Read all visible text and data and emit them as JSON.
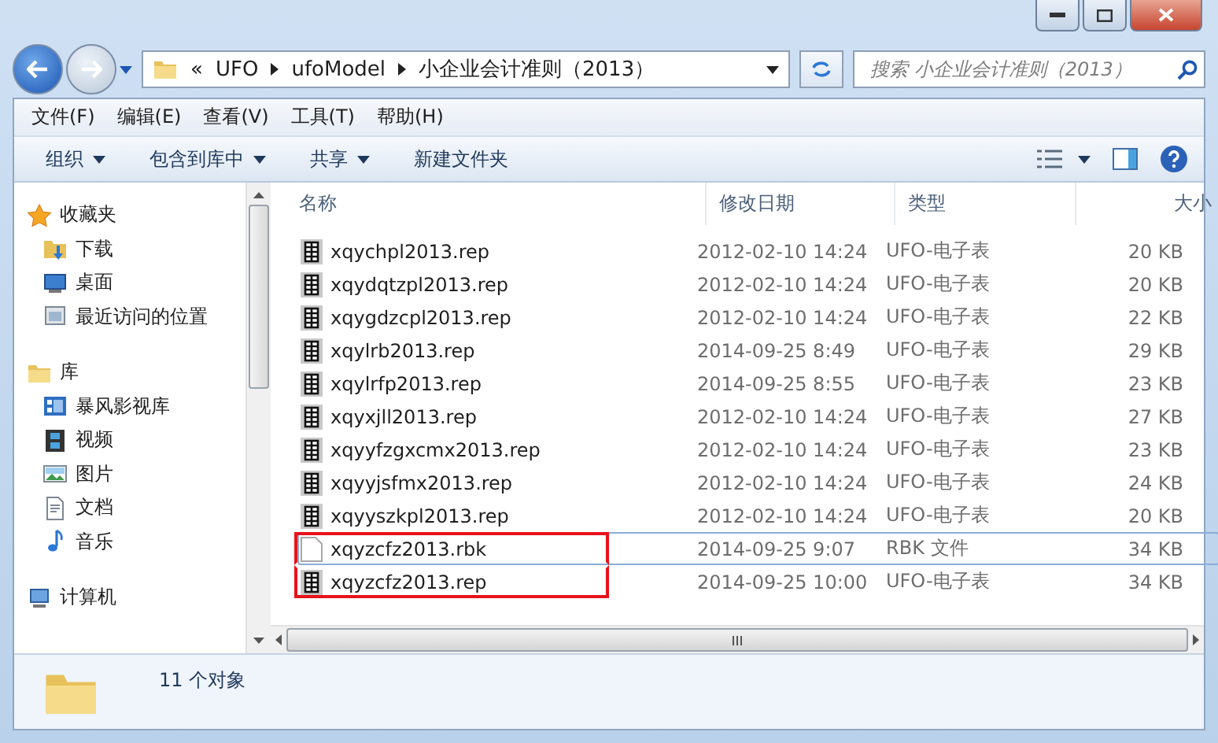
{
  "address": {
    "overflow": "«",
    "crumbs": [
      "UFO",
      "ufoModel",
      "小企业会计准则（2013）"
    ]
  },
  "search": {
    "placeholder": "搜索 小企业会计准则（2013）"
  },
  "menu": [
    "文件(F)",
    "编辑(E)",
    "查看(V)",
    "工具(T)",
    "帮助(H)"
  ],
  "toolbar": [
    {
      "label": "组织",
      "dropdown": true
    },
    {
      "label": "包含到库中",
      "dropdown": true
    },
    {
      "label": "共享",
      "dropdown": true
    },
    {
      "label": "新建文件夹",
      "dropdown": false
    }
  ],
  "sidebar": [
    {
      "label": "收藏夹",
      "kind": "favorites",
      "children": [
        {
          "label": "下载",
          "kind": "download"
        },
        {
          "label": "桌面",
          "kind": "desktop"
        },
        {
          "label": "最近访问的位置",
          "kind": "recent"
        }
      ]
    },
    {
      "label": "库",
      "kind": "library",
      "children": [
        {
          "label": "暴风影视库",
          "kind": "media"
        },
        {
          "label": "视频",
          "kind": "video"
        },
        {
          "label": "图片",
          "kind": "pictures"
        },
        {
          "label": "文档",
          "kind": "documents"
        },
        {
          "label": "音乐",
          "kind": "music"
        }
      ]
    },
    {
      "label": "计算机",
      "kind": "computer"
    }
  ],
  "columns": [
    "名称",
    "修改日期",
    "类型",
    "大小"
  ],
  "files": [
    {
      "name": "xqychpl2013.rep",
      "date": "2012-02-10 14:24",
      "type": "UFO-电子表",
      "size": "20 KB",
      "kind": "rep",
      "selected": false,
      "boxed": false
    },
    {
      "name": "xqydqtzpl2013.rep",
      "date": "2012-02-10 14:24",
      "type": "UFO-电子表",
      "size": "20 KB",
      "kind": "rep",
      "selected": false,
      "boxed": false
    },
    {
      "name": "xqygdzcpl2013.rep",
      "date": "2012-02-10 14:24",
      "type": "UFO-电子表",
      "size": "22 KB",
      "kind": "rep",
      "selected": false,
      "boxed": false
    },
    {
      "name": "xqylrb2013.rep",
      "date": "2014-09-25 8:49",
      "type": "UFO-电子表",
      "size": "29 KB",
      "kind": "rep",
      "selected": false,
      "boxed": false
    },
    {
      "name": "xqylrfp2013.rep",
      "date": "2014-09-25 8:55",
      "type": "UFO-电子表",
      "size": "23 KB",
      "kind": "rep",
      "selected": false,
      "boxed": false
    },
    {
      "name": "xqyxjll2013.rep",
      "date": "2012-02-10 14:24",
      "type": "UFO-电子表",
      "size": "27 KB",
      "kind": "rep",
      "selected": false,
      "boxed": false
    },
    {
      "name": "xqyyfzgxcmx2013.rep",
      "date": "2012-02-10 14:24",
      "type": "UFO-电子表",
      "size": "23 KB",
      "kind": "rep",
      "selected": false,
      "boxed": false
    },
    {
      "name": "xqyyjsfmx2013.rep",
      "date": "2012-02-10 14:24",
      "type": "UFO-电子表",
      "size": "24 KB",
      "kind": "rep",
      "selected": false,
      "boxed": false
    },
    {
      "name": "xqyyszkpl2013.rep",
      "date": "2012-02-10 14:24",
      "type": "UFO-电子表",
      "size": "20 KB",
      "kind": "rep",
      "selected": false,
      "boxed": false
    },
    {
      "name": "xqyzcfz2013.rbk",
      "date": "2014-09-25 9:07",
      "type": "RBK 文件",
      "size": "34 KB",
      "kind": "blank",
      "selected": true,
      "boxed": true
    },
    {
      "name": "xqyzcfz2013.rep",
      "date": "2014-09-25 10:00",
      "type": "UFO-电子表",
      "size": "34 KB",
      "kind": "rep",
      "selected": false,
      "boxed": true
    }
  ],
  "status": {
    "count": "11 个对象"
  }
}
